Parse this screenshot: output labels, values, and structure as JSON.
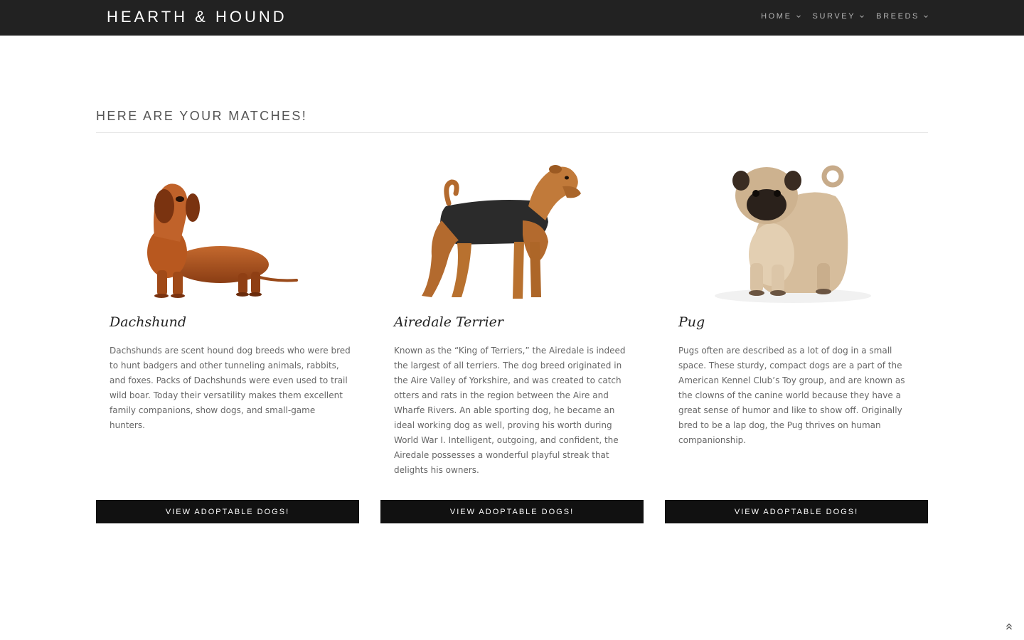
{
  "brand": "HEARTH & HOUND",
  "nav": {
    "items": [
      {
        "label": "HOME",
        "icon": "chevron-down-icon"
      },
      {
        "label": "SURVEY",
        "icon": "chevron-down-icon"
      },
      {
        "label": "BREEDS",
        "icon": "chevron-down-icon"
      }
    ]
  },
  "main": {
    "title": "HERE ARE YOUR MATCHES!",
    "matches": [
      {
        "name": "Dachshund",
        "description": "Dachshunds are scent hound dog breeds who were bred to hunt badgers and other tunneling animals, rabbits, and foxes. Packs of Dachshunds were even used to trail wild boar. Today their versatility makes them excellent family companions, show dogs, and small-game hunters.",
        "button_label": "VIEW ADOPTABLE DOGS!",
        "image": "dachshund-photo"
      },
      {
        "name": "Airedale Terrier",
        "description": "Known as the “King of Terriers,” the Airedale is indeed the largest of all terriers. The dog breed originated in the Aire Valley of Yorkshire, and was created to catch otters and rats in the region between the Aire and Wharfe Rivers. An able sporting dog, he became an ideal working dog as well, proving his worth during World War I. Intelligent, outgoing, and confident, the Airedale possesses a wonderful playful streak that delights his owners.",
        "button_label": "VIEW ADOPTABLE DOGS!",
        "image": "airedale-terrier-photo"
      },
      {
        "name": "Pug",
        "description": "Pugs often are described as a lot of dog in a small space. These sturdy, compact dogs are a part of the American Kennel Club’s Toy group, and are known as the clowns of the canine world because they have a great sense of humor and like to show off. Originally bred to be a lap dog, the Pug thrives on human companionship.",
        "button_label": "VIEW ADOPTABLE DOGS!",
        "image": "pug-photo"
      }
    ]
  },
  "scroll_top_icon": "double-chevron-up-icon",
  "colors": {
    "topbar": "#222222",
    "button": "#111111",
    "text": "#666666"
  }
}
